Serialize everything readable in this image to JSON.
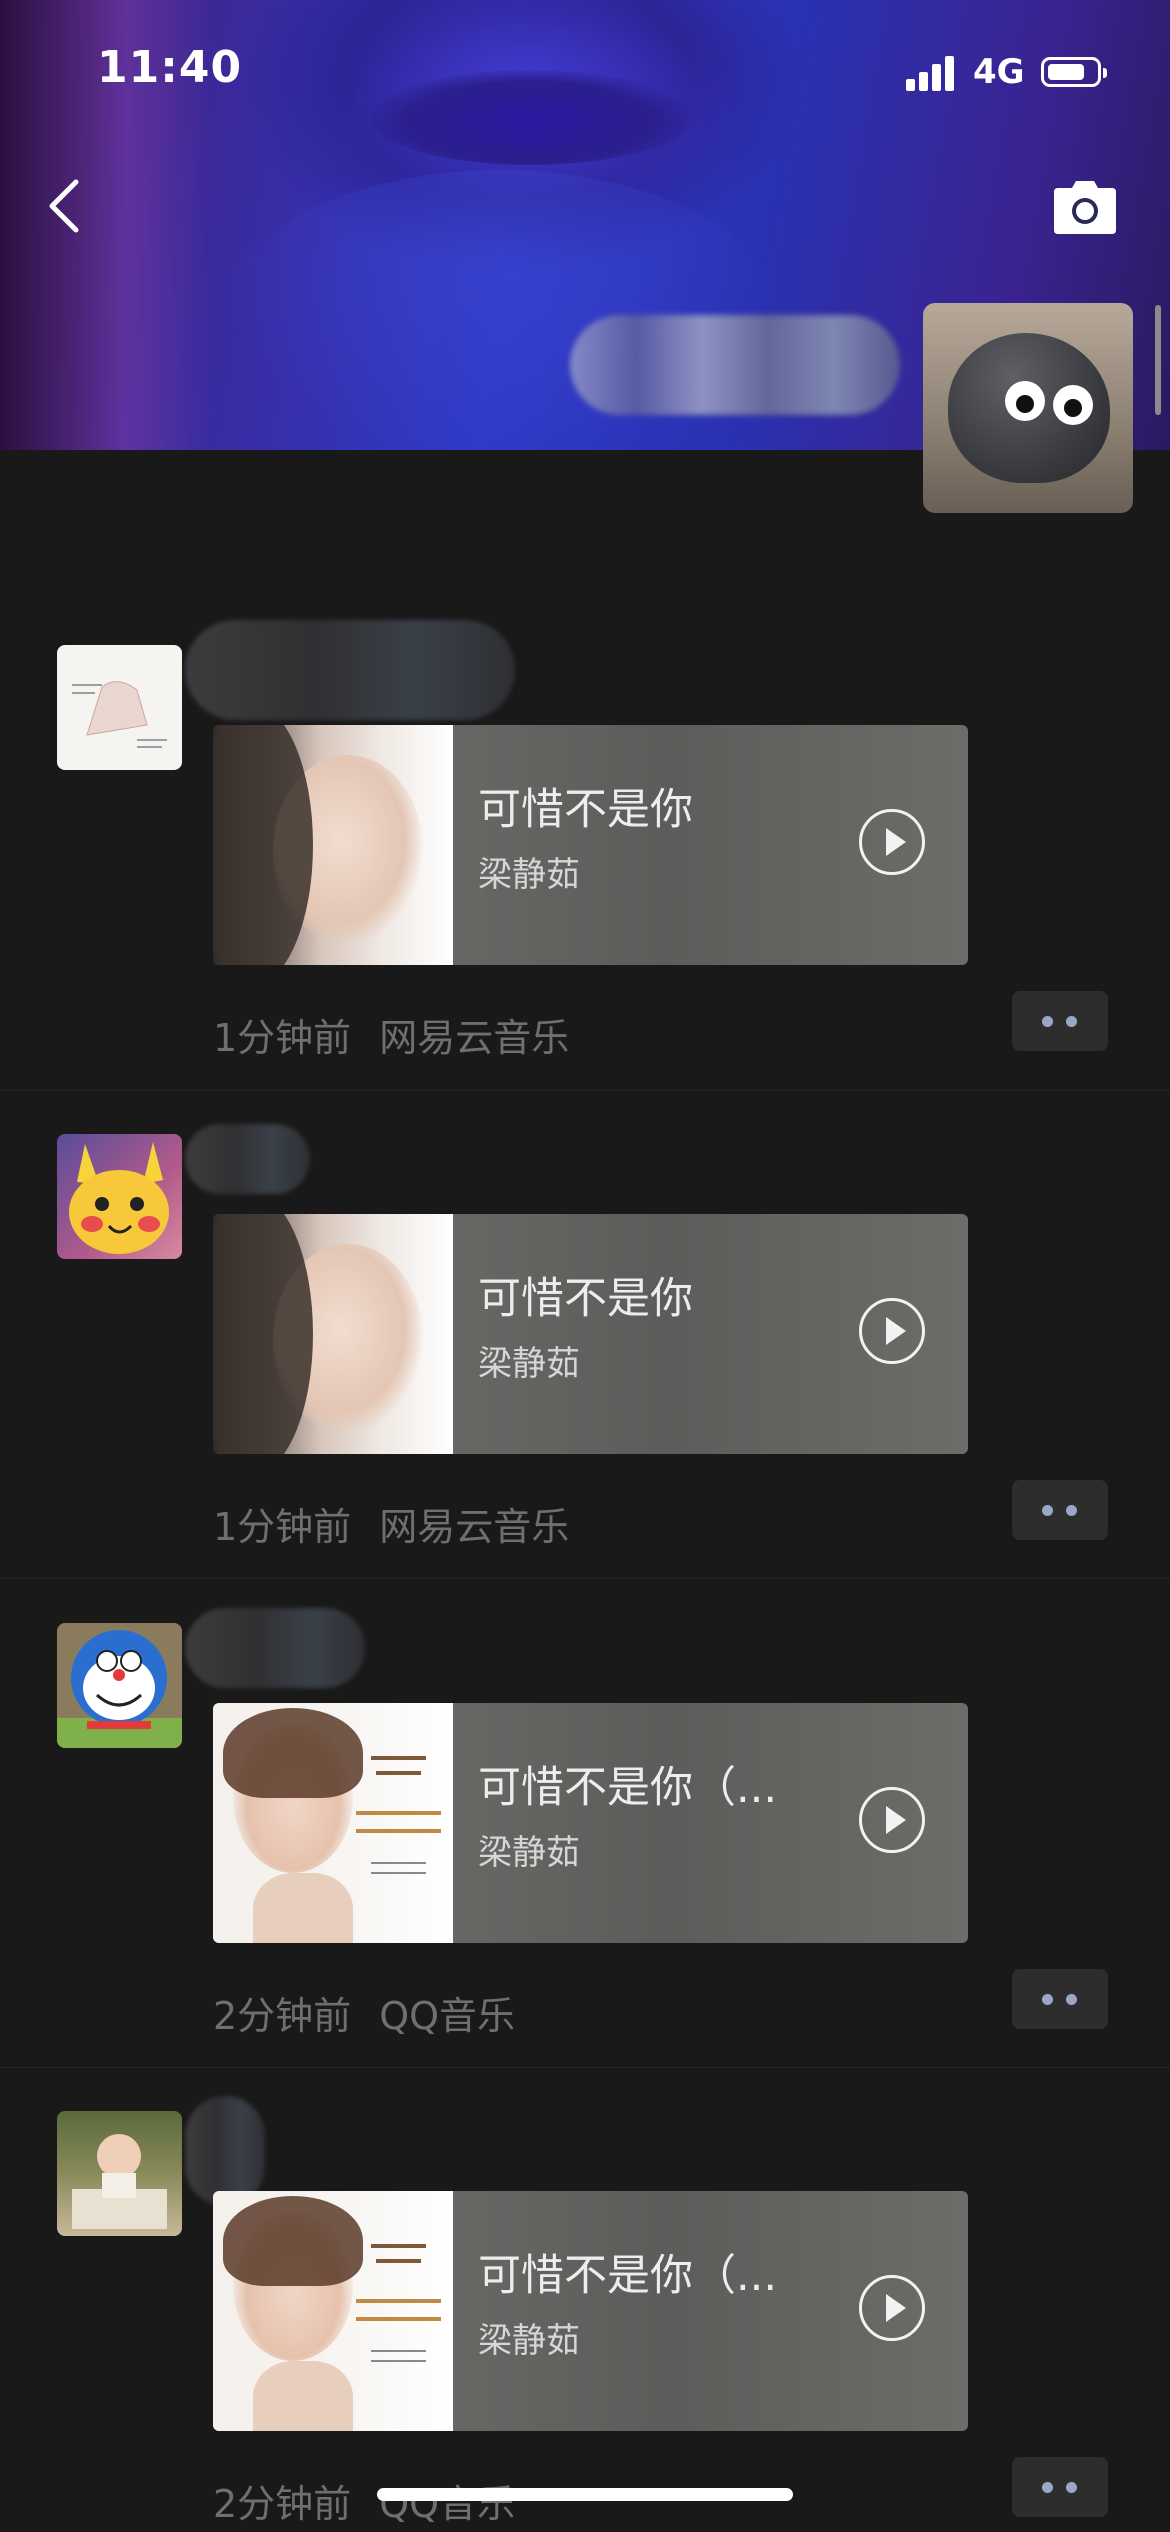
{
  "status_bar": {
    "time": "11:40",
    "network": "4G"
  },
  "cover": {
    "icons": [
      "back-chevron-icon",
      "camera-icon"
    ]
  },
  "feed": [
    {
      "song": "可惜不是你",
      "artist": "梁静茹",
      "time_ago": "1分钟前",
      "source": "网易云音乐"
    },
    {
      "song": "可惜不是你",
      "artist": "梁静茹",
      "time_ago": "1分钟前",
      "source": "网易云音乐"
    },
    {
      "song": "可惜不是你（...",
      "artist": "梁静茹",
      "time_ago": "2分钟前",
      "source": "QQ音乐"
    },
    {
      "song": "可惜不是你（...",
      "artist": "梁静茹",
      "time_ago": "2分钟前",
      "source": "QQ音乐"
    }
  ],
  "colors": {
    "background": "#191919",
    "meta_text": "#6f6f6f",
    "like_dots": "#9aa7c8"
  }
}
